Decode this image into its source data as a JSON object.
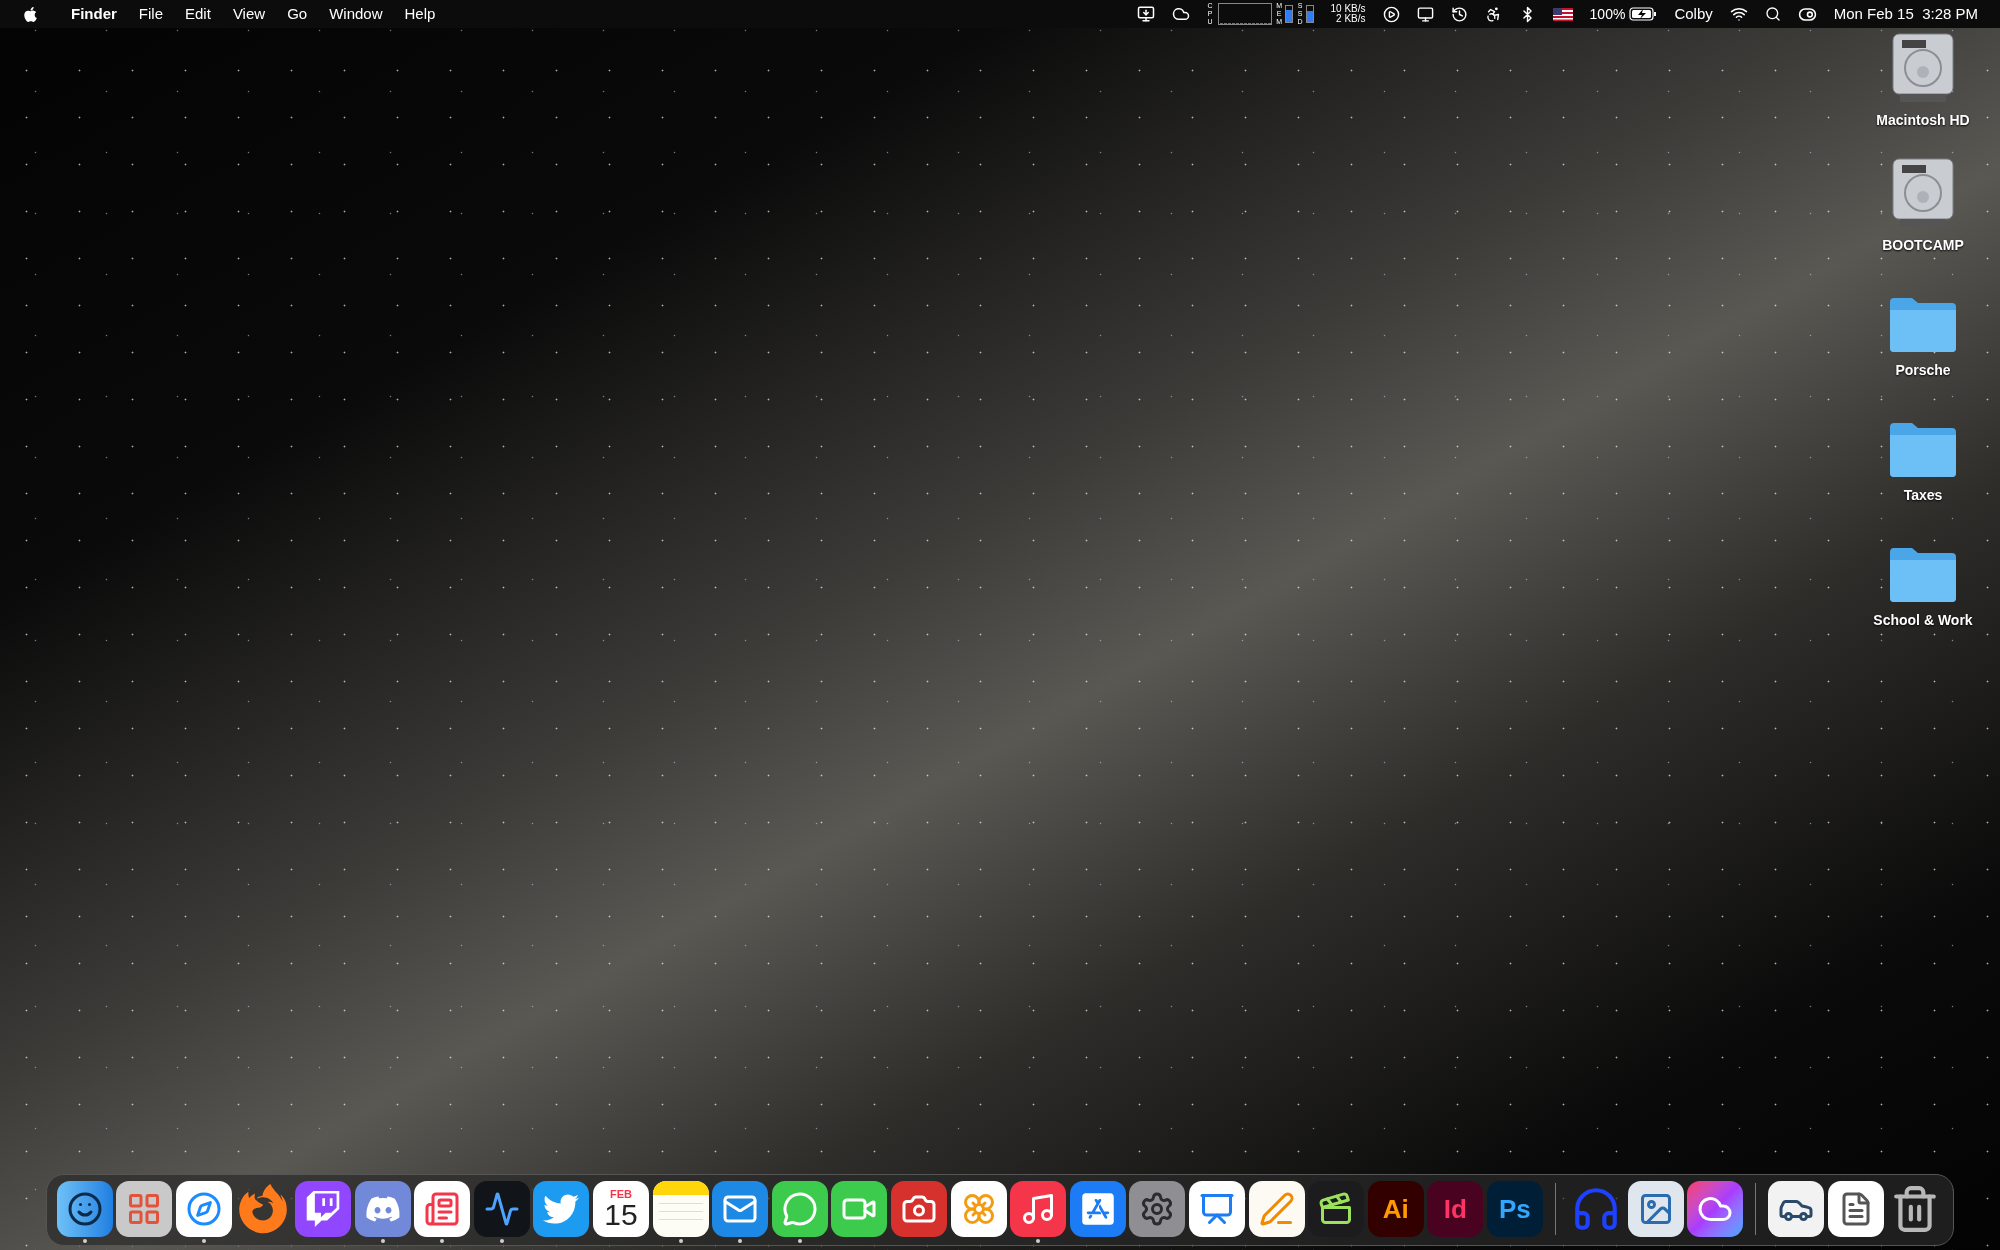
{
  "menu_bar": {
    "app_name": "Finder",
    "menus": [
      "File",
      "Edit",
      "View",
      "Go",
      "Window",
      "Help"
    ],
    "status": {
      "cpu_label": "CPU",
      "mem": {
        "label": "MEM",
        "level": 0.75
      },
      "ssd": {
        "label": "SSD",
        "level": 0.7
      },
      "net_up": "10 KB/s",
      "net_down": "2 KB/s",
      "battery": "100%",
      "user": "Colby",
      "clock": "Mon Feb 15  3:28 PM"
    }
  },
  "desktop_icons": [
    {
      "kind": "disk",
      "label": "Macintosh HD"
    },
    {
      "kind": "disk",
      "label": "BOOTCAMP"
    },
    {
      "kind": "folder",
      "label": "Porsche"
    },
    {
      "kind": "folder",
      "label": "Taxes"
    },
    {
      "kind": "folder",
      "label": "School & Work"
    }
  ],
  "dock": {
    "sections": [
      [
        {
          "kind": "finder",
          "running": true
        },
        {
          "kind": "launchpad",
          "running": false
        },
        {
          "kind": "safari",
          "running": true
        },
        {
          "kind": "firefox",
          "running": false
        },
        {
          "kind": "twitch",
          "running": false
        },
        {
          "kind": "discord",
          "running": true
        },
        {
          "kind": "news",
          "running": true
        },
        {
          "kind": "stocks",
          "running": true
        },
        {
          "kind": "twitter",
          "running": false
        },
        {
          "kind": "calendar",
          "running": false,
          "icon_text": "FEB",
          "icon_text_2": "15"
        },
        {
          "kind": "notes",
          "running": true
        },
        {
          "kind": "mail",
          "running": true
        },
        {
          "kind": "messages",
          "running": true
        },
        {
          "kind": "facetime",
          "running": false
        },
        {
          "kind": "photobooth",
          "running": false
        },
        {
          "kind": "photos",
          "running": false
        },
        {
          "kind": "music",
          "running": true
        },
        {
          "kind": "appstore",
          "running": false
        },
        {
          "kind": "settings",
          "running": false
        },
        {
          "kind": "keynote",
          "running": false
        },
        {
          "kind": "pages",
          "running": false
        },
        {
          "kind": "finalcut",
          "running": false
        },
        {
          "kind": "ai",
          "running": false,
          "icon_text": "Ai"
        },
        {
          "kind": "id",
          "running": false,
          "icon_text": "Id"
        },
        {
          "kind": "ps",
          "running": false,
          "icon_text": "Ps"
        }
      ],
      [
        {
          "kind": "audio",
          "running": false
        },
        {
          "kind": "preview",
          "running": false
        },
        {
          "kind": "cloud",
          "running": false
        }
      ],
      [
        {
          "kind": "photo_doc",
          "running": false
        },
        {
          "kind": "screenshot_doc",
          "running": false
        },
        {
          "kind": "trash",
          "running": false
        }
      ]
    ]
  }
}
